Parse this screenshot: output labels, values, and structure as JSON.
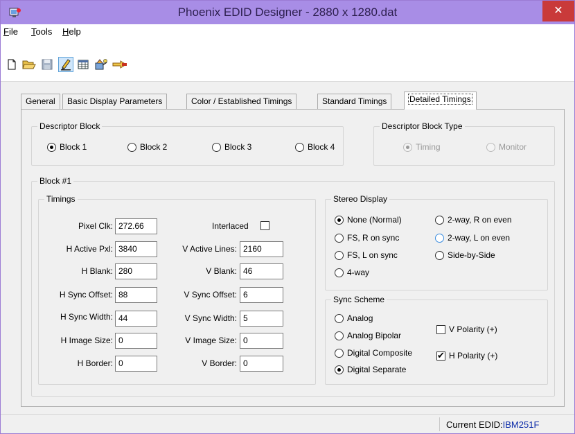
{
  "window": {
    "title": "Phoenix EDID Designer - 2880 x 1280.dat",
    "close_glyph": "✕"
  },
  "menu": [
    "File",
    "Tools",
    "Help"
  ],
  "toolbar": [
    "new-icon",
    "open-folder-icon",
    "save-icon",
    "edit-pencil-icon",
    "table-view-icon",
    "wizard-icon",
    "arrow-icon"
  ],
  "tabs": [
    {
      "label": "General",
      "active": false
    },
    {
      "label": "Basic Display Parameters",
      "active": false
    },
    {
      "label": "Color /  Established Timings",
      "active": false
    },
    {
      "label": "Standard Timings",
      "active": false
    },
    {
      "label": "Detailed Timings",
      "active": true
    }
  ],
  "descriptor_block": {
    "title": "Descriptor Block",
    "options": [
      {
        "label": "Block 1",
        "checked": true
      },
      {
        "label": "Block 2",
        "checked": false
      },
      {
        "label": "Block 3",
        "checked": false
      },
      {
        "label": "Block 4",
        "checked": false
      }
    ]
  },
  "descriptor_type": {
    "title": "Descriptor Block Type",
    "options": [
      {
        "label": "Timing",
        "checked": true
      },
      {
        "label": "Monitor",
        "checked": false
      }
    ]
  },
  "block": {
    "title": "Block #1",
    "timings_title": "Timings",
    "interlaced_label": "Interlaced",
    "interlaced_checked": false,
    "left_fields": [
      {
        "label": "Pixel Clk:",
        "value": "272.66"
      },
      {
        "label": "H Active Pxl:",
        "value": "3840"
      },
      {
        "label": "H Blank:",
        "value": "280"
      },
      {
        "label": "H Sync Offset:",
        "value": "88"
      },
      {
        "label": "H Sync Width:",
        "value": "44"
      },
      {
        "label": "H Image Size:",
        "value": "0"
      },
      {
        "label": "H Border:",
        "value": "0"
      }
    ],
    "right_fields": [
      {
        "label": "V Active Lines:",
        "value": "2160"
      },
      {
        "label": "V Blank:",
        "value": "46"
      },
      {
        "label": "V Sync Offset:",
        "value": "6"
      },
      {
        "label": "V Sync Width:",
        "value": "5"
      },
      {
        "label": "V Image Size:",
        "value": "0"
      },
      {
        "label": "V Border:",
        "value": "0"
      }
    ]
  },
  "stereo": {
    "title": "Stereo Display",
    "options": [
      {
        "label": "None (Normal)",
        "checked": true
      },
      {
        "label": "FS, R on sync",
        "checked": false
      },
      {
        "label": "FS, L on sync",
        "checked": false
      },
      {
        "label": "4-way",
        "checked": false
      },
      {
        "label": "2-way, R on even",
        "checked": false
      },
      {
        "label": "2-way, L on even",
        "checked": false
      },
      {
        "label": "Side-by-Side",
        "checked": false
      }
    ]
  },
  "sync": {
    "title": "Sync Scheme",
    "options": [
      {
        "label": "Analog",
        "checked": false
      },
      {
        "label": "Analog Bipolar",
        "checked": false
      },
      {
        "label": "Digital Composite",
        "checked": false
      },
      {
        "label": "Digital Separate",
        "checked": true
      }
    ],
    "v_polarity": {
      "label": "V Polarity (+)",
      "checked": false
    },
    "h_polarity": {
      "label": "H Polarity (+)",
      "checked": true
    }
  },
  "status": {
    "label": "Current EDID:",
    "value": "IBM251F"
  }
}
